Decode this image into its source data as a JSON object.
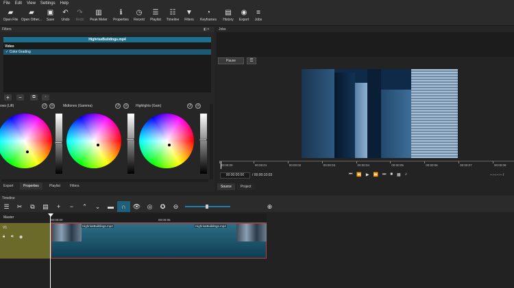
{
  "menu": [
    "File",
    "Edit",
    "View",
    "Settings",
    "Help"
  ],
  "toolbar": [
    {
      "label": "Open File",
      "icon": "folder-icon",
      "glyph": "▰",
      "enabled": true
    },
    {
      "label": "Open Other...",
      "icon": "open-other-icon",
      "glyph": "▰",
      "enabled": true
    },
    {
      "label": "Save",
      "icon": "save-icon",
      "glyph": "▣",
      "enabled": true
    },
    {
      "label": "Undo",
      "icon": "undo-icon",
      "glyph": "↶",
      "enabled": true
    },
    {
      "label": "Redo",
      "icon": "redo-icon",
      "glyph": "↷",
      "enabled": false
    },
    {
      "label": "Peak Meter",
      "icon": "peak-meter-icon",
      "glyph": "▥",
      "enabled": true
    },
    {
      "label": "Properties",
      "icon": "info-icon",
      "glyph": "ℹ",
      "enabled": true
    },
    {
      "label": "Recent",
      "icon": "clock-icon",
      "glyph": "◷",
      "enabled": true
    },
    {
      "label": "Playlist",
      "icon": "playlist-icon",
      "glyph": "☰",
      "enabled": true
    },
    {
      "label": "Timeline",
      "icon": "timeline-icon",
      "glyph": "☷",
      "enabled": true
    },
    {
      "label": "Filters",
      "icon": "funnel-icon",
      "glyph": "▼",
      "enabled": true
    },
    {
      "label": "Keyframes",
      "icon": "stopwatch-icon",
      "glyph": "◔",
      "enabled": true
    },
    {
      "label": "History",
      "icon": "history-icon",
      "glyph": "▤",
      "enabled": true
    },
    {
      "label": "Export",
      "icon": "export-icon",
      "glyph": "◉",
      "enabled": true
    },
    {
      "label": "Jobs",
      "icon": "jobs-icon",
      "glyph": "≡",
      "enabled": true
    }
  ],
  "filters": {
    "panel_title": "Filters",
    "clip_name": "HighriseBuildings.mp4",
    "section": "Video",
    "filter_item": "Color Grading",
    "wheels": [
      {
        "label": "ows (Lift)",
        "dot": [
          0.55,
          0.7
        ]
      },
      {
        "label": "Midtones (Gamma)",
        "dot": [
          0.58,
          0.58
        ]
      },
      {
        "label": "Highlights (Gain)",
        "dot": [
          0.55,
          0.58
        ]
      }
    ],
    "tabs": [
      "Export",
      "Properties",
      "Playlist",
      "Filters"
    ],
    "active_tab": "Properties"
  },
  "jobs": {
    "title": "Jobs"
  },
  "player": {
    "pause_label": "Pause",
    "ruler_labels": [
      "00:00:00",
      "00:00:01",
      "00:00:02",
      "00:00:03",
      "00:00:04",
      "00:00:05",
      "00:00:06",
      "00:00:07",
      "00:00:08"
    ],
    "current_time": "00:00:00:00",
    "total_time": "/ 00:00:10:03",
    "in_out": "--:--:--:-- /",
    "tabs": [
      "Source",
      "Project"
    ]
  },
  "timeline": {
    "title": "Timeline",
    "master": "Master",
    "track": "V1",
    "ruler_labels": [
      "00:00:00",
      "00:00:05"
    ],
    "clip_labels": [
      "HighriseBuildings.mp4",
      "HighriseBuildings.mp4"
    ]
  }
}
